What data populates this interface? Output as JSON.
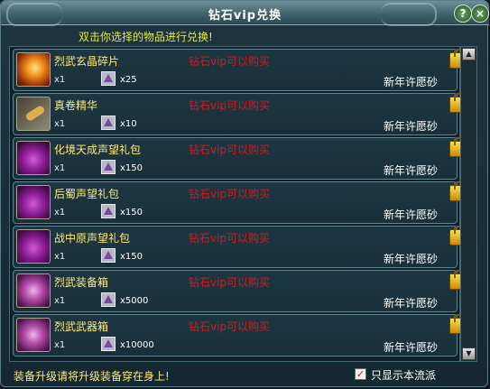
{
  "window": {
    "title": "钻石vip兑换",
    "help_label": "?",
    "close_label": "×",
    "notice": "双击你选择的物品进行兑换!"
  },
  "items": [
    {
      "name": "烈武玄晶碎片",
      "icon": "fire-shard-icon",
      "qty": "x1",
      "cost": "x25",
      "requirement": "钻石vip可以购买",
      "currency": "新年许愿砂"
    },
    {
      "name": "真卷精华",
      "icon": "scroll-essence-icon",
      "qty": "x1",
      "cost": "x10",
      "requirement": "钻石vip可以购买",
      "currency": "新年许愿砂"
    },
    {
      "name": "化境天成声望礼包",
      "icon": "purple-bag-icon",
      "qty": "x1",
      "cost": "x150",
      "requirement": "钻石vip可以购买",
      "currency": "新年许愿砂"
    },
    {
      "name": "后蜀声望礼包",
      "icon": "purple-bag-icon",
      "qty": "x1",
      "cost": "x150",
      "requirement": "钻石vip可以购买",
      "currency": "新年许愿砂"
    },
    {
      "name": "战中原声望礼包",
      "icon": "purple-bag-icon",
      "qty": "x1",
      "cost": "x150",
      "requirement": "钻石vip可以购买",
      "currency": "新年许愿砂"
    },
    {
      "name": "烈武装备箱",
      "icon": "pink-chest-icon",
      "qty": "x1",
      "cost": "x5000",
      "requirement": "钻石vip可以购买",
      "currency": "新年许愿砂"
    },
    {
      "name": "烈武武器箱",
      "icon": "pink-chest-icon",
      "qty": "x1",
      "cost": "x10000",
      "requirement": "钻石vip可以购买",
      "currency": "新年许愿砂"
    }
  ],
  "footer": {
    "hint": "装备升级请将升级装备穿在身上!",
    "filter_label": "只显示本流派",
    "filter_checked": true
  },
  "colors": {
    "item_name": "#ffe874",
    "requirement": "#e01414",
    "notice": "#e8ec22"
  }
}
